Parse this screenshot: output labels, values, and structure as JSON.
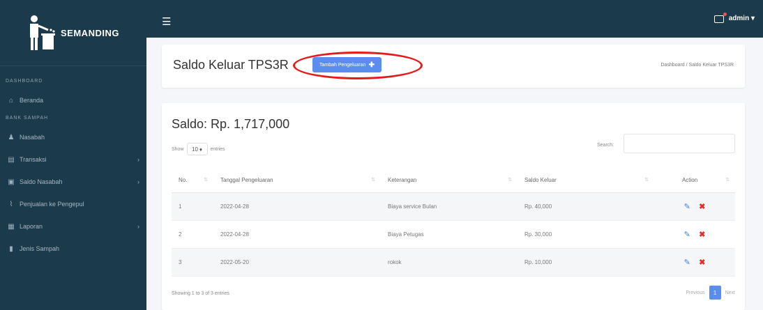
{
  "brand": {
    "name": "SEMANDING"
  },
  "sidebar": {
    "sections": [
      {
        "title": "DASHBOARD",
        "items": [
          {
            "label": "Beranda",
            "icon": "home-icon",
            "has_children": false
          }
        ]
      },
      {
        "title": "BANK SAMPAH",
        "items": [
          {
            "label": "Nasabah",
            "icon": "users-icon",
            "has_children": false
          },
          {
            "label": "Transaksi",
            "icon": "clipboard-icon",
            "has_children": true
          },
          {
            "label": "Saldo Nasabah",
            "icon": "wallet-icon",
            "has_children": true
          },
          {
            "label": "Penjualan ke Pengepul",
            "icon": "chart-icon",
            "has_children": false
          },
          {
            "label": "Laporan",
            "icon": "report-icon",
            "has_children": true
          },
          {
            "label": "Jenis Sampah",
            "icon": "trash-icon",
            "has_children": false
          }
        ]
      }
    ]
  },
  "topbar": {
    "username": "admin"
  },
  "header": {
    "title": "Saldo Keluar TPS3R",
    "add_button": "Tambah Pengeluaran",
    "breadcrumb": "Dashboard / Saldo Keluar TPS3R"
  },
  "main": {
    "saldo": "Saldo: Rp. 1,717,000",
    "show_label": "Show",
    "entries_value": "10",
    "entries_label": "entries",
    "search_label": "Search:",
    "search_value": "",
    "columns": [
      "No.",
      "Tanggal Pengeluaran",
      "Keterangan",
      "Saldo Keluar",
      "Action"
    ],
    "rows": [
      {
        "no": "1",
        "tanggal": "2022-04-28",
        "keterangan": "Biaya service Bulan",
        "saldo": "Rp. 40,000"
      },
      {
        "no": "2",
        "tanggal": "2022-04-28",
        "keterangan": "Biaya Petugas",
        "saldo": "Rp. 30,000"
      },
      {
        "no": "3",
        "tanggal": "2022-05-20",
        "keterangan": "rokok",
        "saldo": "Rp. 10,000"
      }
    ],
    "info": "Showing 1 to 3 of 3 entries",
    "pagination": {
      "previous": "Previous",
      "page": "1",
      "next": "Next"
    }
  },
  "colors": {
    "sidebar_bg": "#1b3a4b",
    "primary": "#5a8dee",
    "highlight": "#e41b1b",
    "delete": "#e03131"
  }
}
